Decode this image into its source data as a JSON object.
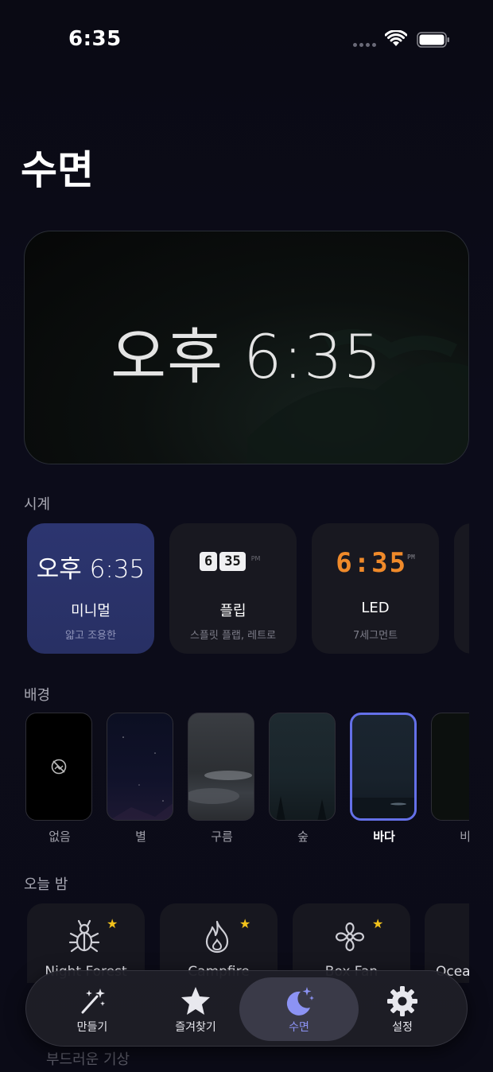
{
  "status_bar": {
    "time": "6:35"
  },
  "page": {
    "title": "수면"
  },
  "preview": {
    "clock_text": "오후 6:35"
  },
  "clock_section": {
    "label": "시계",
    "styles": [
      {
        "id": "minimal",
        "preview": "오후 6:35",
        "title": "미니멀",
        "subtitle": "얇고 조용한",
        "selected": true
      },
      {
        "id": "flip",
        "preview_hour": "6",
        "preview_min": "35",
        "preview_ampm": "PM",
        "title": "플립",
        "subtitle": "스플릿 플랩, 레트로",
        "selected": false
      },
      {
        "id": "led",
        "preview": "6:35",
        "preview_ampm": "PM",
        "title": "LED",
        "subtitle": "7세그먼트",
        "selected": false
      }
    ]
  },
  "background_section": {
    "label": "배경",
    "items": [
      {
        "label": "없음",
        "icon": "no-image-icon",
        "selected": false
      },
      {
        "label": "별",
        "selected": false
      },
      {
        "label": "구름",
        "selected": false
      },
      {
        "label": "숲",
        "selected": false
      },
      {
        "label": "바다",
        "selected": true
      },
      {
        "label": "비",
        "selected": false
      }
    ]
  },
  "tonight_section": {
    "label": "오늘 밤",
    "sounds": [
      {
        "name": "Night Forest",
        "icon": "bug-icon",
        "favorite": true
      },
      {
        "name": "Campfire",
        "icon": "flame-icon",
        "favorite": true
      },
      {
        "name": "Box Fan",
        "icon": "fan-icon",
        "favorite": true
      },
      {
        "name": "Ocean",
        "icon": "wave-icon",
        "favorite": false
      }
    ]
  },
  "behind_text": "부드러운 기상",
  "tab_bar": {
    "tabs": [
      {
        "label": "만들기",
        "icon": "magic-wand-icon",
        "active": false
      },
      {
        "label": "즐겨찾기",
        "icon": "star-icon",
        "active": false
      },
      {
        "label": "수면",
        "icon": "moon-stars-icon",
        "active": true
      },
      {
        "label": "설정",
        "icon": "gear-icon",
        "active": false
      }
    ]
  },
  "colors": {
    "accent": "#8c93f4",
    "selected_card": "#2c3570",
    "led": "#f08a2a",
    "favorite_star": "#f2c21b"
  }
}
